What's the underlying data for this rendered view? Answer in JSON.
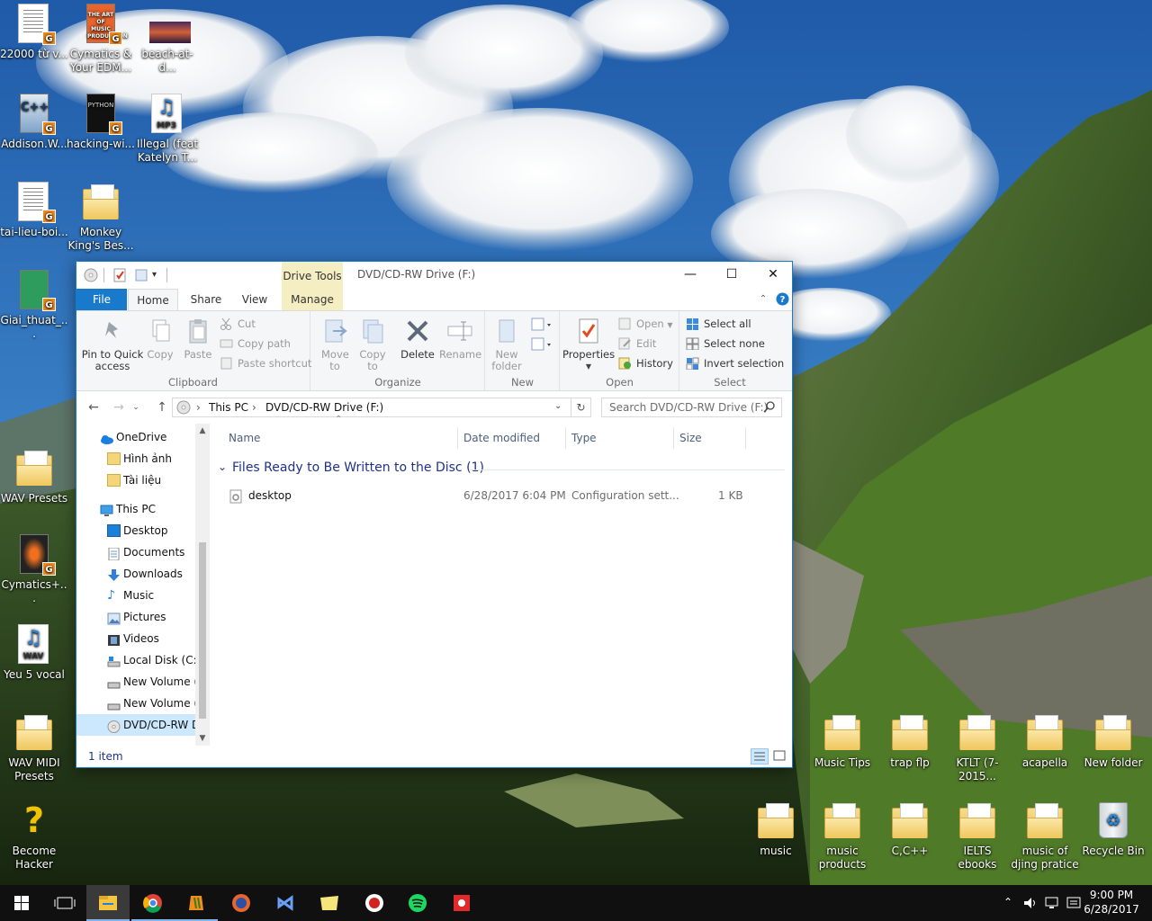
{
  "desktop": {
    "icons": [
      {
        "label": "22000 từ v..."
      },
      {
        "label": "Cymatics & Your EDM..."
      },
      {
        "label": "beach-at-d..."
      },
      {
        "label": "Addison.W..."
      },
      {
        "label": "hacking-wi..."
      },
      {
        "label": "Illegal (feat Katelyn T..."
      },
      {
        "label": "tai-lieu-boi..."
      },
      {
        "label": "Monkey King's Bes..."
      },
      {
        "label": "Giai_thuat_..."
      },
      {
        "label": "WAV Presets"
      },
      {
        "label": "Cymatics+..."
      },
      {
        "label": "Yeu 5 vocal"
      },
      {
        "label": "WAV MIDI Presets"
      },
      {
        "label": "Become Hacker"
      },
      {
        "label": "Music Tips"
      },
      {
        "label": "trap flp"
      },
      {
        "label": "KTLT (7-2015..."
      },
      {
        "label": "acapella"
      },
      {
        "label": "New folder"
      },
      {
        "label": "music"
      },
      {
        "label": "music products"
      },
      {
        "label": "C,C++"
      },
      {
        "label": "IELTS ebooks"
      },
      {
        "label": "music of djing pratice"
      },
      {
        "label": "Recycle Bin"
      }
    ],
    "book_cover_texts": {
      "music": "THE ART OF MUSIC PRODUCTION",
      "cpp": "C++",
      "python": "PYTHON"
    },
    "mp3_tag": "MP3",
    "wav_tag": "WAV"
  },
  "window": {
    "title": "DVD/CD-RW Drive (F:)",
    "context_tab": "Drive Tools",
    "tabs": {
      "file": "File",
      "home": "Home",
      "share": "Share",
      "view": "View",
      "manage": "Manage"
    },
    "ribbon": {
      "clipboard": {
        "group": "Clipboard",
        "pin": "Pin to Quick access",
        "copy": "Copy",
        "paste": "Paste",
        "cut": "Cut",
        "copy_path": "Copy path",
        "paste_shortcut": "Paste shortcut"
      },
      "organize": {
        "group": "Organize",
        "move_to": "Move to",
        "copy_to": "Copy to",
        "delete": "Delete",
        "rename": "Rename"
      },
      "new": {
        "group": "New",
        "new_folder": "New folder"
      },
      "open": {
        "group": "Open",
        "properties": "Properties",
        "open": "Open",
        "edit": "Edit",
        "history": "History"
      },
      "select": {
        "group": "Select",
        "select_all": "Select all",
        "select_none": "Select none",
        "invert": "Invert selection"
      }
    },
    "address": {
      "crumb1": "This PC",
      "crumb2": "DVD/CD-RW Drive (F:)"
    },
    "search_placeholder": "Search DVD/CD-RW Drive (F:)",
    "nav": {
      "onedrive": "OneDrive",
      "hinh_anh": "Hình ảnh",
      "tai_lieu": "Tài liệu",
      "this_pc": "This PC",
      "desktop": "Desktop",
      "documents": "Documents",
      "downloads": "Downloads",
      "music": "Music",
      "pictures": "Pictures",
      "videos": "Videos",
      "local_disk": "Local Disk (C:)",
      "new_volume_d": "New Volume (D",
      "new_volume_e": "New Volume (E",
      "dvd": "DVD/CD-RW D"
    },
    "columns": {
      "name": "Name",
      "date": "Date modified",
      "type": "Type",
      "size": "Size"
    },
    "group_header": "Files Ready to Be Written to the Disc (1)",
    "files": [
      {
        "name": "desktop",
        "date": "6/28/2017 6:04 PM",
        "type": "Configuration sett...",
        "size": "1 KB"
      }
    ],
    "status": "1 item"
  },
  "taskbar": {
    "time": "9:00 PM",
    "date": "6/28/2017"
  }
}
